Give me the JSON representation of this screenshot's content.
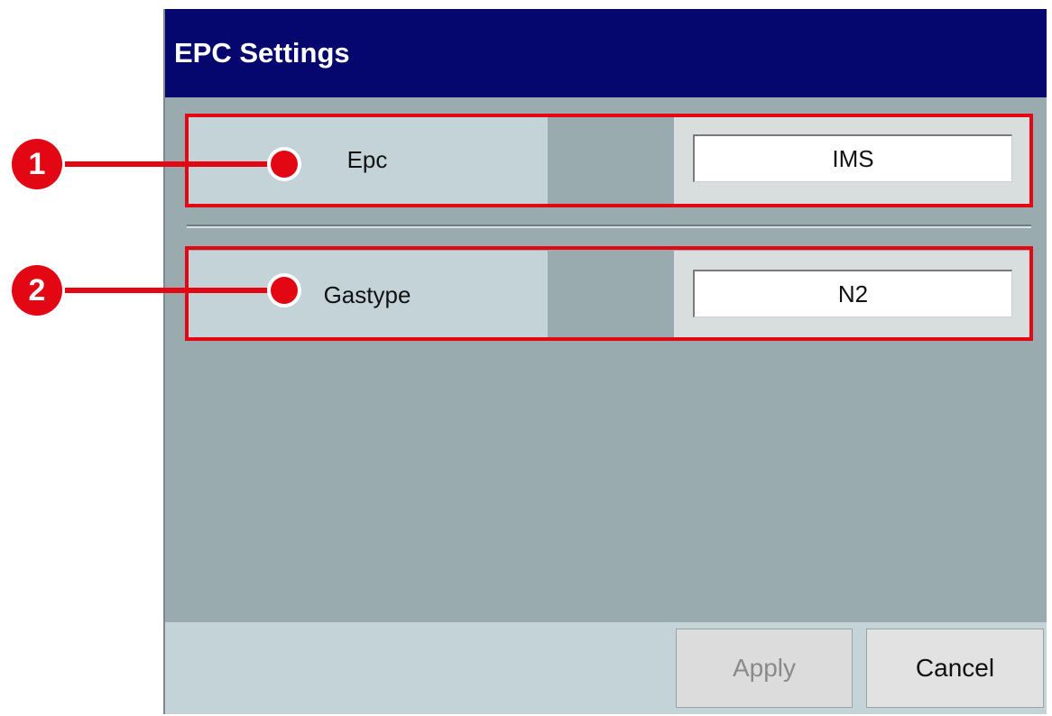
{
  "dialog": {
    "title": "EPC Settings"
  },
  "settings": [
    {
      "label": "Epc",
      "value": "IMS"
    },
    {
      "label": "Gastype",
      "value": "N2"
    }
  ],
  "footer": {
    "apply_label": "Apply",
    "cancel_label": "Cancel"
  },
  "callouts": [
    "1",
    "2"
  ],
  "colors": {
    "title_bar": "#06066f",
    "panel": "#9aabaf",
    "label_cell": "#c4d3d8",
    "highlight": "#e30613"
  }
}
